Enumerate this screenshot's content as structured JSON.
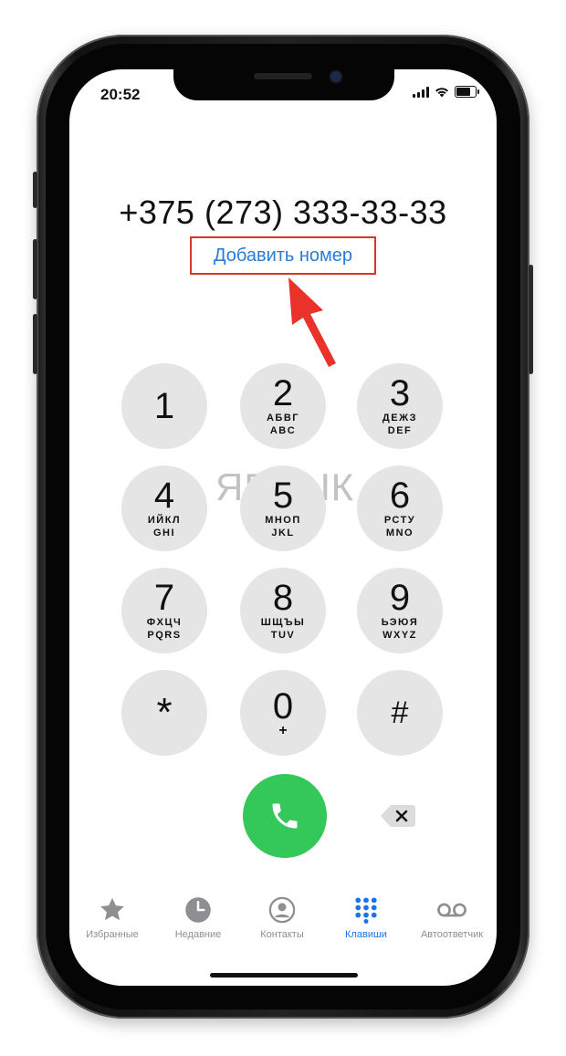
{
  "status": {
    "time": "20:52"
  },
  "dialer": {
    "number": "+375 (273) 333-33-33",
    "add_number": "Добавить номер"
  },
  "watermark": "ЯБЛЫК",
  "keys": [
    {
      "digit": "1",
      "l1": "",
      "l2": ""
    },
    {
      "digit": "2",
      "l1": "АБВГ",
      "l2": "ABC"
    },
    {
      "digit": "3",
      "l1": "ДЕЖЗ",
      "l2": "DEF"
    },
    {
      "digit": "4",
      "l1": "ИЙКЛ",
      "l2": "GHI"
    },
    {
      "digit": "5",
      "l1": "МНОП",
      "l2": "JKL"
    },
    {
      "digit": "6",
      "l1": "РСТУ",
      "l2": "MNO"
    },
    {
      "digit": "7",
      "l1": "ФХЦЧ",
      "l2": "PQRS"
    },
    {
      "digit": "8",
      "l1": "ШЩЪЫ",
      "l2": "TUV"
    },
    {
      "digit": "9",
      "l1": "ЬЭЮЯ",
      "l2": "WXYZ"
    },
    {
      "digit": "*",
      "l1": "",
      "l2": ""
    },
    {
      "digit": "0",
      "plus": "+"
    },
    {
      "digit": "#",
      "l1": "",
      "l2": ""
    }
  ],
  "tabs": [
    {
      "label": "Избранные",
      "icon": "star-icon"
    },
    {
      "label": "Недавние",
      "icon": "clock-icon"
    },
    {
      "label": "Контакты",
      "icon": "contact-icon"
    },
    {
      "label": "Клавиши",
      "icon": "keypad-icon",
      "active": true
    },
    {
      "label": "Автоответчик",
      "icon": "voicemail-icon"
    }
  ],
  "colors": {
    "call_green": "#34c759",
    "accent_blue": "#1a73e8",
    "highlight_red": "#d9362b",
    "key_gray": "#e5e5e5"
  }
}
